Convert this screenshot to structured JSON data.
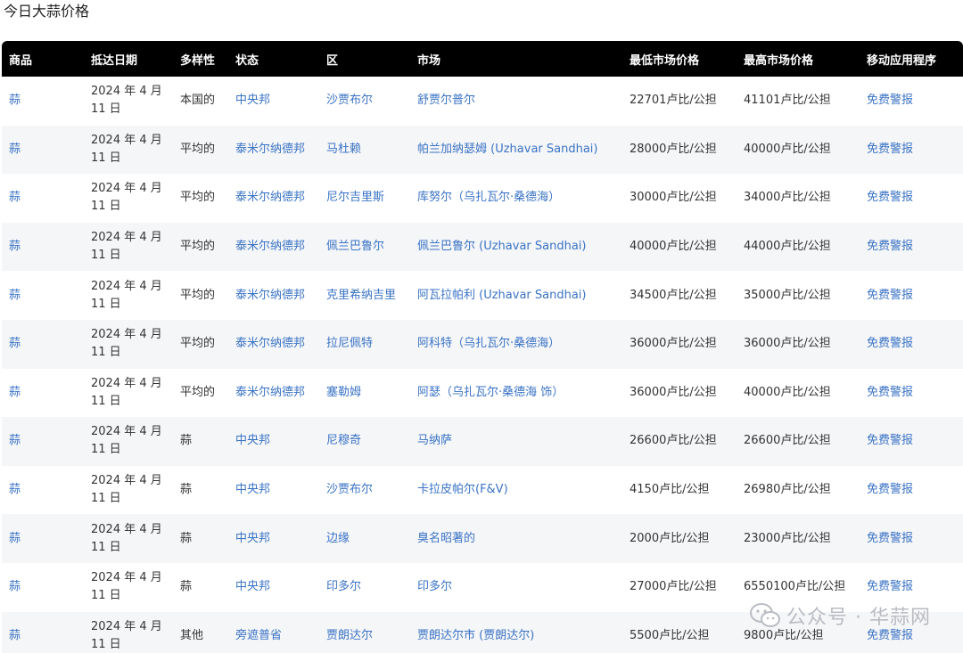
{
  "page": {
    "title": "今日大蒜价格"
  },
  "table": {
    "headers": [
      "商品",
      "抵达日期",
      "多样性",
      "状态",
      "区",
      "市场",
      "最低市场价格",
      "最高市场价格",
      "移动应用程序"
    ],
    "rows": [
      [
        "蒜",
        "2024 年 4 月 11 日",
        "本国的",
        "中央邦",
        "沙贾布尔",
        "舒贾尔普尔",
        "22701卢比/公担",
        "41101卢比/公担",
        "免费警报"
      ],
      [
        "蒜",
        "2024 年 4 月 11 日",
        "平均的",
        "泰米尔纳德邦",
        "马杜赖",
        "帕兰加纳瑟姆 (Uzhavar Sandhai)",
        "28000卢比/公担",
        "40000卢比/公担",
        "免费警报"
      ],
      [
        "蒜",
        "2024 年 4 月 11 日",
        "平均的",
        "泰米尔纳德邦",
        "尼尔吉里斯",
        "库努尔（乌扎瓦尔·桑德海）",
        "30000卢比/公担",
        "34000卢比/公担",
        "免费警报"
      ],
      [
        "蒜",
        "2024 年 4 月 11 日",
        "平均的",
        "泰米尔纳德邦",
        "佩兰巴鲁尔",
        "佩兰巴鲁尔 (Uzhavar Sandhai)",
        "40000卢比/公担",
        "44000卢比/公担",
        "免费警报"
      ],
      [
        "蒜",
        "2024 年 4 月 11 日",
        "平均的",
        "泰米尔纳德邦",
        "克里希纳吉里",
        "阿瓦拉帕利 (Uzhavar Sandhai)",
        "34500卢比/公担",
        "35000卢比/公担",
        "免费警报"
      ],
      [
        "蒜",
        "2024 年 4 月 11 日",
        "平均的",
        "泰米尔纳德邦",
        "拉尼佩特",
        "阿科特（乌扎瓦尔·桑德海）",
        "36000卢比/公担",
        "36000卢比/公担",
        "免费警报"
      ],
      [
        "蒜",
        "2024 年 4 月 11 日",
        "平均的",
        "泰米尔纳德邦",
        "塞勒姆",
        "阿瑟（乌扎瓦尔·桑德海 饰）",
        "36000卢比/公担",
        "40000卢比/公担",
        "免费警报"
      ],
      [
        "蒜",
        "2024 年 4 月 11 日",
        "蒜",
        "中央邦",
        "尼穆奇",
        "马纳萨",
        "26600卢比/公担",
        "26600卢比/公担",
        "免费警报"
      ],
      [
        "蒜",
        "2024 年 4 月 11 日",
        "蒜",
        "中央邦",
        "沙贾布尔",
        "卡拉皮帕尔(F&V)",
        "4150卢比/公担",
        "26980卢比/公担",
        "免费警报"
      ],
      [
        "蒜",
        "2024 年 4 月 11 日",
        "蒜",
        "中央邦",
        "边缘",
        "臭名昭著的",
        "2000卢比/公担",
        "23000卢比/公担",
        "免费警报"
      ],
      [
        "蒜",
        "2024 年 4 月 11 日",
        "蒜",
        "中央邦",
        "印多尔",
        "印多尔",
        "27000卢比/公担",
        "6550100卢比/公担",
        "免费警报"
      ],
      [
        "蒜",
        "2024 年 4 月 11 日",
        "其他",
        "旁遮普省",
        "贾朗达尔",
        "贾朗达尔市 (贾朗达尔)",
        "5500卢比/公担",
        "9800卢比/公担",
        "免费警报"
      ]
    ]
  },
  "watermark": {
    "text": "公众号 · 华蒜网",
    "icon": "wechat-icon"
  }
}
